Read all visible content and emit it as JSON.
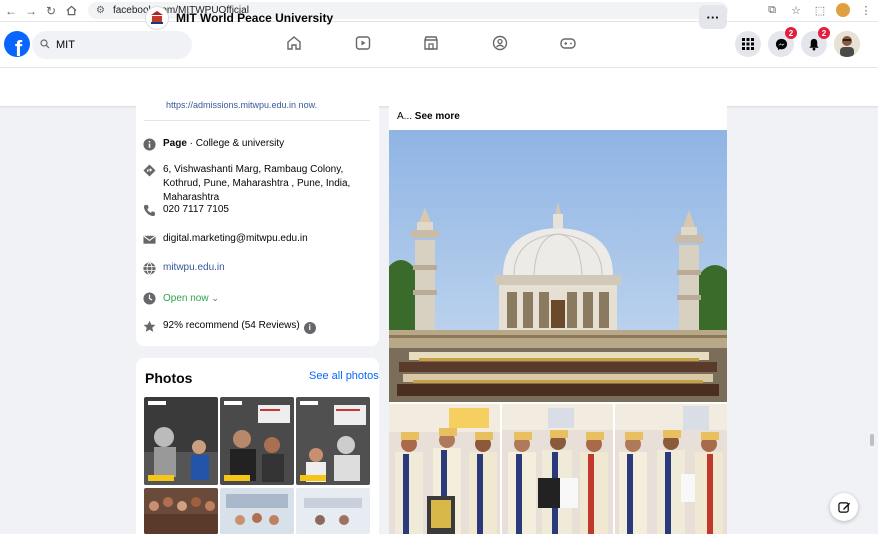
{
  "browser": {
    "url": "facebook.com/MITWPUOfficial"
  },
  "fb": {
    "search_value": "MIT",
    "notifications": {
      "messenger_count": "2",
      "bell_count": "2"
    }
  },
  "page_header": {
    "title": "MIT World Peace University",
    "more_label": "···"
  },
  "intro": {
    "cut_text": "https://admissions.mitwpu.edu.in now.",
    "items": [
      {
        "strong": "Page",
        "text": " · College & university"
      },
      {
        "text": "6, Vishwashanti Marg, Rambaug Colony, Kothrud, Pune, Maharashtra , Pune, India, Maharashtra"
      },
      {
        "text": "020 7117 7105"
      },
      {
        "text": "digital.marketing@mitwpu.edu.in"
      },
      {
        "text": "mitwpu.edu.in"
      },
      {
        "text": "Open now",
        "suffix": "⌄"
      },
      {
        "text": "92% recommend (54 Reviews)",
        "info": "i"
      }
    ]
  },
  "photos": {
    "title": "Photos",
    "see_all": "See all photos"
  },
  "post": {
    "cut_text": "",
    "see_more_prefix": "A... ",
    "see_more_label": "See more"
  },
  "colors": {
    "fb_blue": "#0866ff",
    "link": "#385898",
    "badge_red": "#e41e3f",
    "open_green": "#31a24c"
  }
}
